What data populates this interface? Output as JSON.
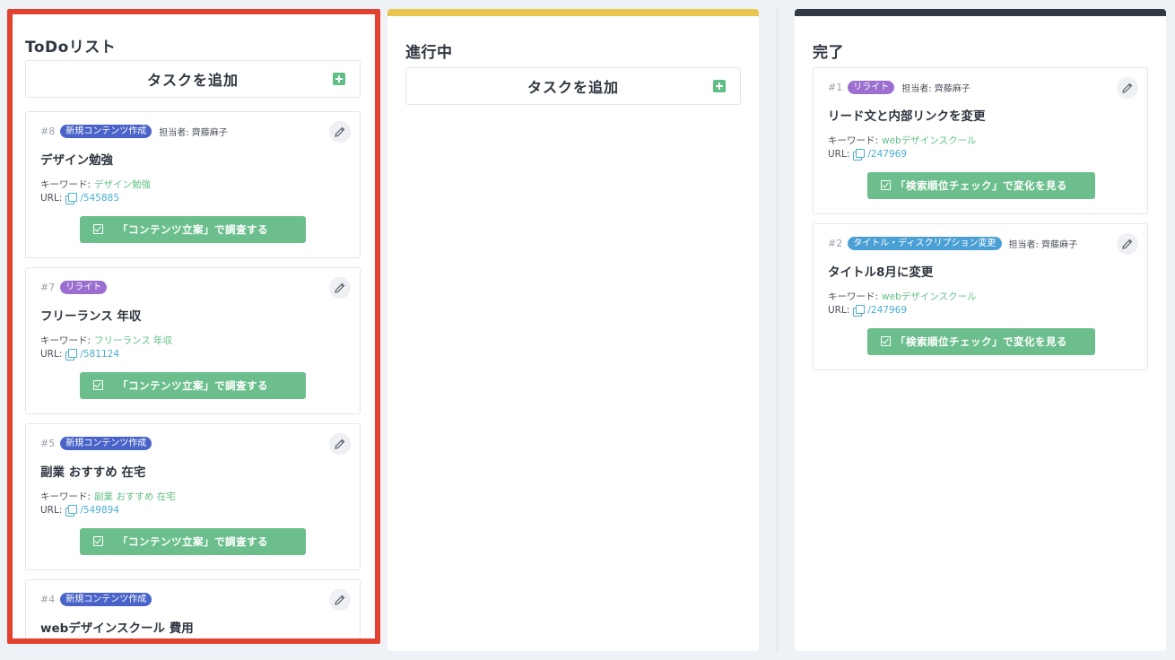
{
  "columns": {
    "todo": {
      "title": "ToDoリスト",
      "add_label": "タスクを追加",
      "cards": [
        {
          "num": "#8",
          "tag": "新規コンテンツ作成",
          "assignee": "担当者: 齊藤麻子",
          "title": "デザイン勉強",
          "kw_label": "キーワード:",
          "kw": "デザイン勉強",
          "url_label": "URL:",
          "url": "/545885",
          "action": "「コンテンツ立案」で調査する"
        },
        {
          "num": "#7",
          "tag": "リライト",
          "assignee": "",
          "title": "フリーランス 年収",
          "kw_label": "キーワード:",
          "kw": "フリーランス 年収",
          "url_label": "URL:",
          "url": "/581124",
          "action": "「コンテンツ立案」で調査する"
        },
        {
          "num": "#5",
          "tag": "新規コンテンツ作成",
          "assignee": "",
          "title": "副業 おすすめ 在宅",
          "kw_label": "キーワード:",
          "kw": "副業 おすすめ 在宅",
          "url_label": "URL:",
          "url": "/549894",
          "action": "「コンテンツ立案」で調査する"
        },
        {
          "num": "#4",
          "tag": "新規コンテンツ作成",
          "assignee": "",
          "title": "webデザインスクール 費用"
        }
      ]
    },
    "progress": {
      "title": "進行中",
      "add_label": "タスクを追加"
    },
    "done": {
      "title": "完了",
      "cards": [
        {
          "num": "#1",
          "tag": "リライト",
          "assignee": "担当者: 齊藤麻子",
          "title": "リード文と内部リンクを変更",
          "kw_label": "キーワード:",
          "kw": "webデザインスクール",
          "url_label": "URL:",
          "url": "/247969",
          "action": "「検索順位チェック」で変化を見る"
        },
        {
          "num": "#2",
          "tag": "タイトル・ディスクリプション変更",
          "assignee": "担当者: 齊藤麻子",
          "title": "タイトル8月に変更",
          "kw_label": "キーワード:",
          "kw": "webデザインスクール",
          "url_label": "URL:",
          "url": "/247969",
          "action": "「検索順位チェック」で変化を見る"
        }
      ]
    }
  },
  "icons": {
    "add": "plus-square-icon",
    "edit": "pencil-icon",
    "copy": "copy-icon",
    "check": "checkbox-icon"
  },
  "colors": {
    "todo_highlight": "#e3412f",
    "progress_accent": "#e9c44f",
    "done_accent": "#323a46",
    "action": "#6cbf8d",
    "tag_new": "#4963c8",
    "tag_rewrite": "#9b6fd0",
    "tag_title": "#4a9fd5"
  }
}
